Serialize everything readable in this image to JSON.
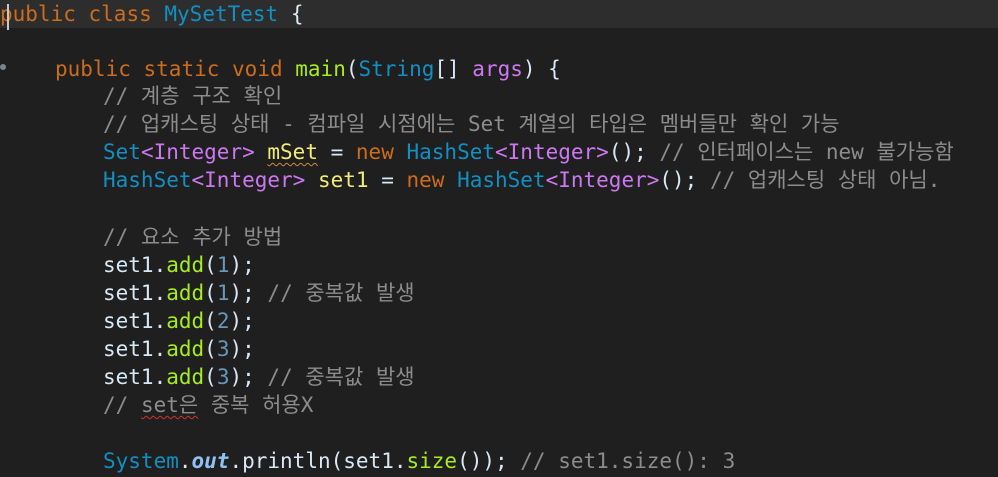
{
  "code": {
    "l1": {
      "kw1": "public",
      "kw2": "class",
      "name": "MySetTest",
      "brace": "{"
    },
    "l3": {
      "kw1": "public",
      "kw2": "static",
      "kw3": "void",
      "fn": "main",
      "p1": "(",
      "cls": "String",
      "arr": "[] ",
      "arg": "args",
      "p2": ") {"
    },
    "l4": "// 계층 구조 확인",
    "l5": "// 업캐스팅 상태 - 컴파일 시점에는 Set 계열의 타입은 멤버들만 확인 가능",
    "l6": {
      "cls1": "Set",
      "g1": "<Integer>",
      "var": "mSet",
      "eq": " = ",
      "kw": "new",
      "cls2": "HashSet",
      "g2": "<Integer>",
      "end": "();",
      "cm": " // 인터페이스는 new 불가능함"
    },
    "l7": {
      "cls1": "HashSet",
      "g1": "<Integer>",
      "var": "set1",
      "eq": " = ",
      "kw": "new",
      "cls2": "HashSet",
      "g2": "<Integer>",
      "end": "();",
      "cm": " // 업캐스팅 상태 아님."
    },
    "l9": "// 요소 추가 방법",
    "adds": [
      {
        "obj": "set1",
        "dot": ".",
        "fn": "add",
        "open": "(",
        "num": "1",
        "close": ");",
        "cm": ""
      },
      {
        "obj": "set1",
        "dot": ".",
        "fn": "add",
        "open": "(",
        "num": "1",
        "close": ");",
        "cm": " // 중복값 발생"
      },
      {
        "obj": "set1",
        "dot": ".",
        "fn": "add",
        "open": "(",
        "num": "2",
        "close": ");",
        "cm": ""
      },
      {
        "obj": "set1",
        "dot": ".",
        "fn": "add",
        "open": "(",
        "num": "3",
        "close": ");",
        "cm": ""
      },
      {
        "obj": "set1",
        "dot": ".",
        "fn": "add",
        "open": "(",
        "num": "3",
        "close": ");",
        "cm": " // 중복값 발생"
      }
    ],
    "l15": {
      "pre": "// ",
      "sq": "set은",
      "post": " 중복 허용X"
    },
    "l17": {
      "cls": "System",
      "d1": ".",
      "fld": "out",
      "d2": ".",
      "fn": "println",
      "a": "(set1.",
      "fn2": "size",
      "b": "());",
      "cm": " // set1.size(): 3"
    }
  },
  "colors": {
    "background": "#1f1f1f",
    "keyword": "#cc6c1d",
    "class": "#1290c3",
    "method": "#a7ec21",
    "generic": "#cd78f0",
    "variable": "#f3ec79",
    "comment": "#8c8c8c",
    "number": "#6897bb"
  }
}
